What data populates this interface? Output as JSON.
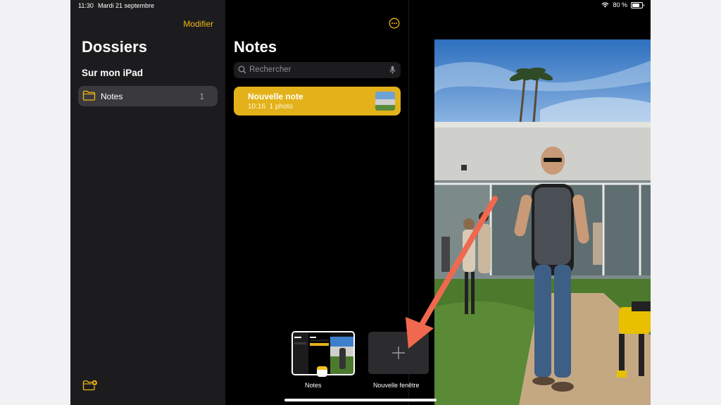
{
  "status": {
    "time": "11:30",
    "date": "Mardi 21 septembre",
    "battery": "80 %",
    "battery_level": 0.8
  },
  "sidebar": {
    "edit_label": "Modifier",
    "title": "Dossiers",
    "section": "Sur mon iPad",
    "folders": [
      {
        "label": "Notes",
        "count": "1"
      }
    ]
  },
  "notes": {
    "title": "Notes",
    "search_placeholder": "Rechercher",
    "items": [
      {
        "title": "Nouvelle note",
        "time": "10:16",
        "meta": "1 photo"
      }
    ]
  },
  "shelf": {
    "app_label": "Notes",
    "new_window_label": "Nouvelle fenêtre"
  },
  "colors": {
    "accent": "#f2b714",
    "annotation_arrow": "#f0694f"
  }
}
